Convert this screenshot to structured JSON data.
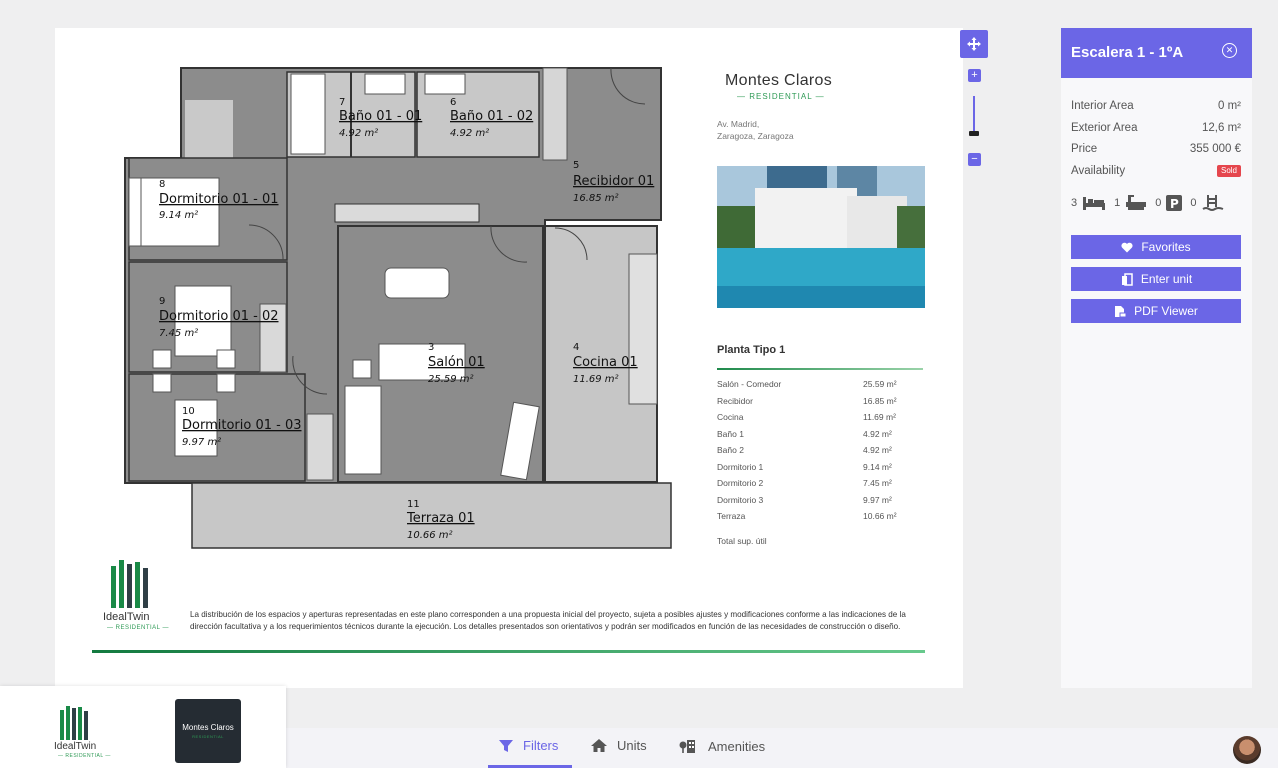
{
  "sheet": {
    "brand_title": "Montes Claros",
    "brand_subtitle": "RESIDENTIAL",
    "address_line1": "Av. Madrid,",
    "address_line2": "Zaragoza, Zaragoza",
    "schedule_title": "Planta Tipo 1",
    "schedule": [
      {
        "room": "Salón - Comedor",
        "area": "25.59 m²"
      },
      {
        "room": "Recibidor",
        "area": "16.85 m²"
      },
      {
        "room": "Cocina",
        "area": "11.69 m²"
      },
      {
        "room": "Baño 1",
        "area": "4.92 m²"
      },
      {
        "room": "Baño 2",
        "area": "4.92 m²"
      },
      {
        "room": "Dormitorio 1",
        "area": "9.14 m²"
      },
      {
        "room": "Dormitorio 2",
        "area": "7.45 m²"
      },
      {
        "room": "Dormitorio 3",
        "area": "9.97 m²"
      },
      {
        "room": "Terraza",
        "area": "10.66 m²"
      }
    ],
    "total_label": "Total sup. útil",
    "disclaimer": "La distribución de los espacios y aperturas representadas en este plano corresponden a una propuesta inicial del proyecto, sujeta a posibles ajustes y modificaciones conforme a las indicaciones de la dirección facultativa y a los requerimientos técnicos durante la ejecución. Los detalles presentados son orientativos y podrán ser modificados en función de las necesidades de construcción o diseño.",
    "logo_name": "IdealTwin",
    "logo_sub": "RESIDENTIAL"
  },
  "plan": {
    "rooms": [
      {
        "num": "7",
        "name": "Baño 01 - 01",
        "area": "4.92 m²"
      },
      {
        "num": "6",
        "name": "Baño 01 - 02",
        "area": "4.92 m²"
      },
      {
        "num": "5",
        "name": "Recibidor 01",
        "area": "16.85 m²"
      },
      {
        "num": "8",
        "name": "Dormitorio 01 - 01",
        "area": "9.14 m²"
      },
      {
        "num": "9",
        "name": "Dormitorio 01 - 02",
        "area": "7.45 m²"
      },
      {
        "num": "3",
        "name": "Salón 01",
        "area": "25.59 m²"
      },
      {
        "num": "4",
        "name": "Cocina 01",
        "area": "11.69 m²"
      },
      {
        "num": "10",
        "name": "Dormitorio 01 - 03",
        "area": "9.97 m²"
      },
      {
        "num": "11",
        "name": "Terraza 01",
        "area": "10.66 m²"
      }
    ]
  },
  "panel": {
    "title": "Escalera 1 - 1ºA",
    "interior_label": "Interior Area",
    "interior_value": "0 m²",
    "exterior_label": "Exterior Area",
    "exterior_value": "12,6 m²",
    "price_label": "Price",
    "price_value": "355 000 €",
    "availability_label": "Availability",
    "availability_value": "Sold",
    "bedrooms": "3",
    "bathrooms": "1",
    "parking": "0",
    "pools": "0",
    "favorites_label": "Favorites",
    "enter_label": "Enter unit",
    "pdf_label": "PDF Viewer"
  },
  "bottom": {
    "logo_name": "IdealTwin",
    "logo_sub": "RESIDENTIAL",
    "mc_name": "Montes Claros",
    "mc_sub": "RESIDENTIAL",
    "nav": {
      "filters": "Filters",
      "units": "Units",
      "amenities": "Amenities"
    }
  },
  "colors": {
    "accent": "#6b66e6",
    "sold": "#e5464d",
    "brand_green": "#2e9a55"
  }
}
